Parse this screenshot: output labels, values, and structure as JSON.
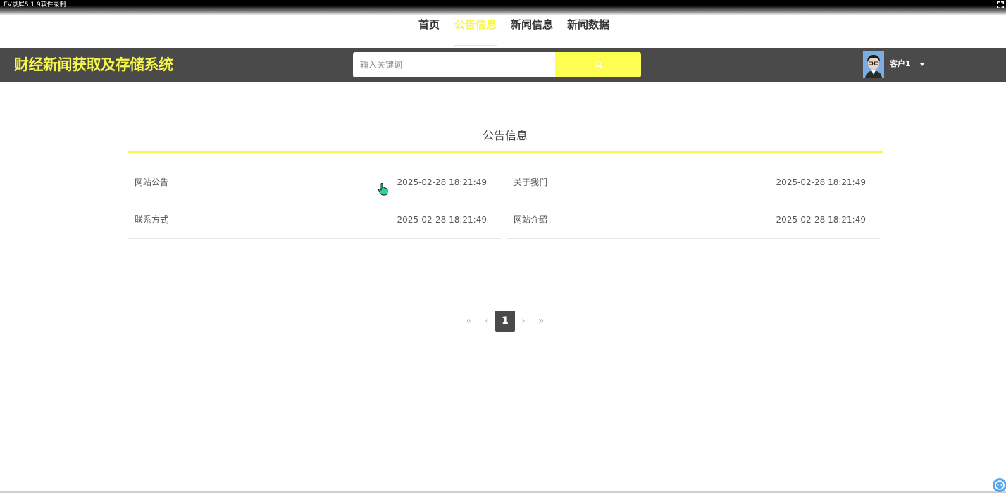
{
  "recorder": {
    "title": "EV录屏5.1.9软件录制"
  },
  "nav": {
    "items": [
      {
        "label": "首页",
        "active": false
      },
      {
        "label": "公告信息",
        "active": true
      },
      {
        "label": "新闻信息",
        "active": false
      },
      {
        "label": "新闻数据",
        "active": false
      }
    ]
  },
  "header": {
    "site_title": "财经新闻获取及存储系统",
    "search_placeholder": "输入关键词",
    "search_value": "",
    "user_name": "客户1"
  },
  "section": {
    "title": "公告信息",
    "notices": [
      {
        "title": "网站公告",
        "date": "2025-02-28 18:21:49"
      },
      {
        "title": "关于我们",
        "date": "2025-02-28 18:21:49"
      },
      {
        "title": "联系方式",
        "date": "2025-02-28 18:21:49"
      },
      {
        "title": "网站介绍",
        "date": "2025-02-28 18:21:49"
      }
    ]
  },
  "pagination": {
    "first": "«",
    "prev": "‹",
    "current": "1",
    "next": "›",
    "last": "»"
  },
  "colors": {
    "accent": "#f7f74a",
    "header_bg": "#4a4a4a",
    "page_bg": "#ffffff"
  }
}
